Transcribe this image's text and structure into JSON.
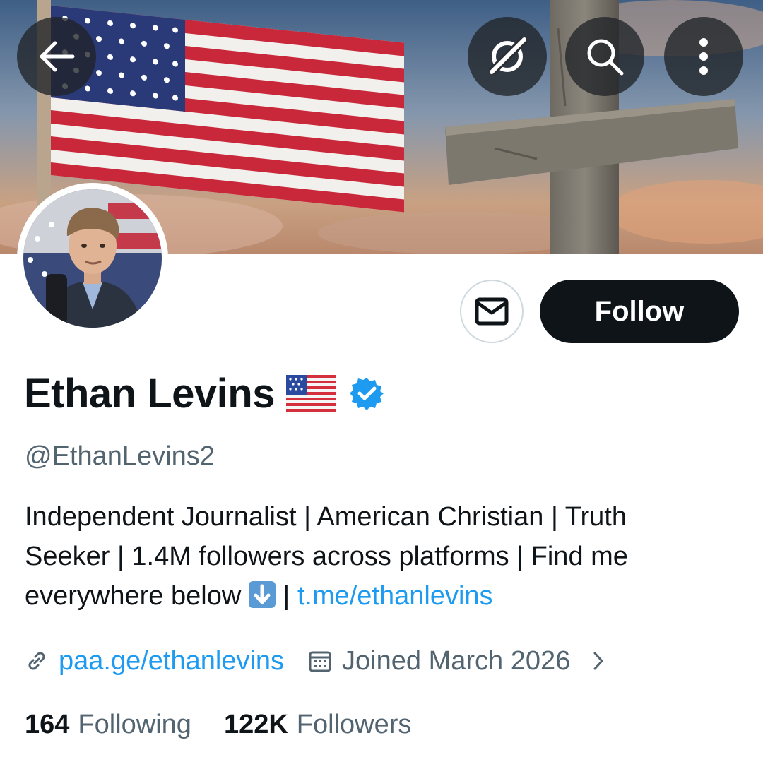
{
  "header": {
    "back_icon": "arrow-left-icon",
    "grok_icon": "grok-icon",
    "search_icon": "search-icon",
    "more_icon": "more-vertical-icon"
  },
  "banner": {
    "description_icons": [
      "american-flag",
      "stone-cross"
    ]
  },
  "profile": {
    "display_name": "Ethan Levins",
    "handle": "@EthanLevins2",
    "verified": true,
    "verified_color": "#1d9bf0",
    "bio": {
      "line1": "Independent Journalist | American Christian | Truth",
      "line2": "Seeker | 1.4M followers across platforms | Find me",
      "line3_prefix": "everywhere below ",
      "line3_sep": " | ",
      "line3_link": "t.me/ethanlevins"
    },
    "website": "paa.ge/ethanlevins",
    "joined": "Joined March 2026",
    "following_count": "164",
    "following_label": "Following",
    "followers_count": "122K",
    "followers_label": "Followers"
  },
  "actions": {
    "message_icon": "envelope-icon",
    "follow_label": "Follow"
  },
  "colors": {
    "accent": "#1d9bf0",
    "text_primary": "#0f1419",
    "text_secondary": "#536471",
    "follow_bg": "#0f1419"
  }
}
